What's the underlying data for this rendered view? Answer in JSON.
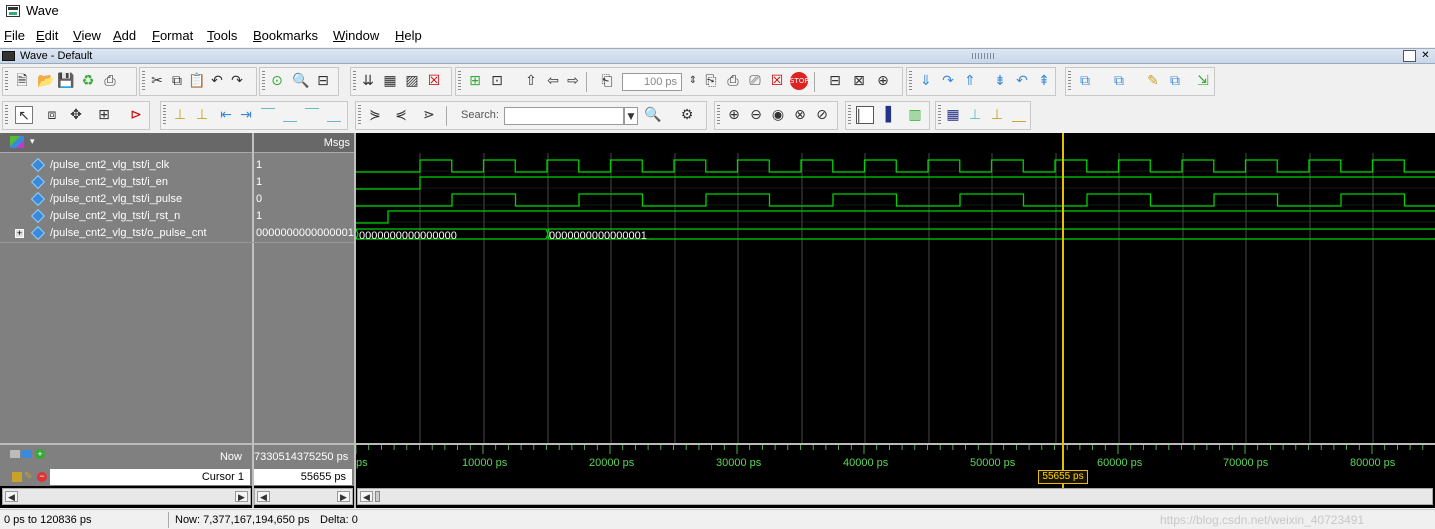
{
  "window": {
    "title": "Wave"
  },
  "menu": [
    "File",
    "Edit",
    "View",
    "Add",
    "Format",
    "Tools",
    "Bookmarks",
    "Window",
    "Help"
  ],
  "subwindow": {
    "title": "Wave - Default"
  },
  "toolbar": {
    "time_step_value": "100 ps",
    "search_label": "Search:",
    "search_value": ""
  },
  "columns": {
    "msgs": "Msgs"
  },
  "signals": [
    {
      "name": "/pulse_cnt2_vlg_tst/i_clk",
      "value": "1"
    },
    {
      "name": "/pulse_cnt2_vlg_tst/i_en",
      "value": "1"
    },
    {
      "name": "/pulse_cnt2_vlg_tst/i_pulse",
      "value": "0"
    },
    {
      "name": "/pulse_cnt2_vlg_tst/i_rst_n",
      "value": "1"
    },
    {
      "name": "/pulse_cnt2_vlg_tst/o_pulse_cnt",
      "value": "0000000000000001"
    }
  ],
  "bus_values": [
    "0000000000000000",
    "0000000000000001"
  ],
  "now": {
    "label": "Now",
    "value": "7330514375250 ps"
  },
  "cursor": {
    "label": "Cursor 1",
    "value": "55655 ps",
    "flag": "55655 ps"
  },
  "timeline": {
    "first_label": "ps",
    "ticks": [
      "10000 ps",
      "20000 ps",
      "30000 ps",
      "40000 ps",
      "50000 ps",
      "60000 ps",
      "70000 ps",
      "80000 ps"
    ]
  },
  "status": {
    "range": "0 ps to 120836 ps",
    "now": "Now: 7,377,167,194,650 ps",
    "delta": "Delta: 0",
    "watermark": "https://blog.csdn.net/weixin_40723491"
  },
  "colors": {
    "wave": "#00d200",
    "cursor": "#e6c000",
    "grid": "#5a5a5a"
  }
}
